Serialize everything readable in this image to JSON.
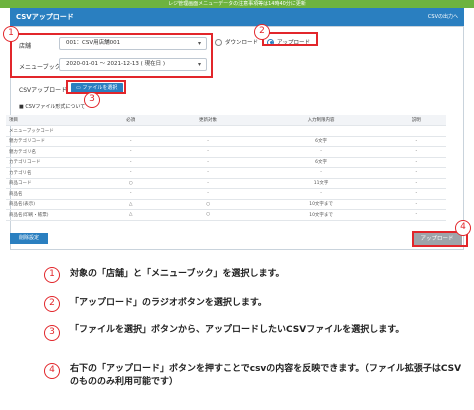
{
  "notice": "レジ管理画面メニューデータの注意事項等は14時40分に更新",
  "title": "CSVアップロード",
  "title_right": "CSVの出力へ",
  "form": {
    "store_label": "店舗",
    "store_value": "001：CSV用店舗001",
    "menubook_label": "メニューブック",
    "menubook_value": "2020-01-01 ～ 2021-12-13 ( 現在日 )",
    "download_label": "ダウンロード",
    "upload_label": "アップロード",
    "csv_label": "CSVアップロード",
    "file_button": "ファイルを選択",
    "format_note": "■ CSVファイル形式について"
  },
  "table": {
    "headers": [
      "項目",
      "必須",
      "更新対象",
      "入力制限内容",
      "説明"
    ],
    "rows": [
      [
        "メニューブックコード",
        "",
        "",
        "",
        ""
      ],
      [
        "親カテゴリコード",
        "-",
        "-",
        "6文字",
        "-"
      ],
      [
        "親カテゴリ名",
        "-",
        "-",
        "-",
        "-"
      ],
      [
        "カテゴリコード",
        "-",
        "-",
        "6文字",
        "-"
      ],
      [
        "カテゴリ名",
        "-",
        "-",
        "-",
        "-"
      ],
      [
        "商品コード",
        "○",
        "-",
        "11文字",
        "-"
      ],
      [
        "商品名",
        "-",
        "-",
        "-",
        "-"
      ],
      [
        "商品名(表示)",
        "△",
        "○",
        "10文字まで",
        "-"
      ],
      [
        "商品名(印刷・帳票)",
        "△",
        "○",
        "10文字まで",
        "-"
      ]
    ]
  },
  "buttons": {
    "bottom_left": "削除設定",
    "upload": "アップロード"
  },
  "markers": [
    "1",
    "2",
    "3",
    "4"
  ],
  "instructions": [
    {
      "num": "1",
      "text": "対象の「店舗」と「メニューブック」を選択します。"
    },
    {
      "num": "2",
      "text": "「アップロード」のラジオボタンを選択します。"
    },
    {
      "num": "3",
      "text": "「ファイルを選択」ボタンから、アップロードしたいCSVファイルを選択します。"
    },
    {
      "num": "4",
      "text": "右下の「アップロード」ボタンを押すことでcsvの内容を反映できます。（ファイル拡張子はCSVのもののみ利用可能です）"
    }
  ],
  "colors": {
    "accent": "#2a7fc0",
    "marker": "#e2262b",
    "notice": "#6db33f",
    "disabled": "#9ea4aa"
  }
}
